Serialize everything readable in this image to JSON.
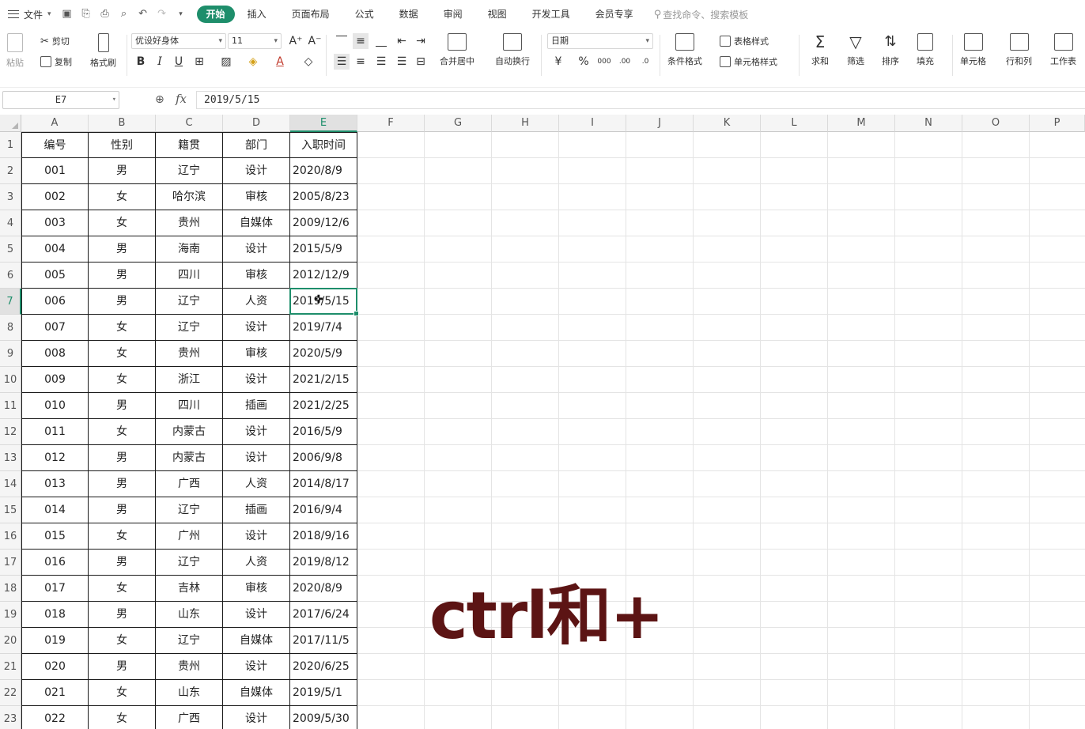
{
  "menu": {
    "file_label": "文件",
    "tabs": [
      "开始",
      "插入",
      "页面布局",
      "公式",
      "数据",
      "审阅",
      "视图",
      "开发工具",
      "会员专享"
    ],
    "active_tab": "开始",
    "search_placeholder": "查找命令、搜索模板"
  },
  "ribbon": {
    "paste": "粘贴",
    "cut": "剪切",
    "copy": "复制",
    "format_painter": "格式刷",
    "font_name": "优设好身体",
    "font_size": "11",
    "merge_center": "合并居中",
    "wrap_text": "自动换行",
    "number_format": "日期",
    "conditional_format": "条件格式",
    "table_style": "表格样式",
    "cell_style": "单元格样式",
    "sum": "求和",
    "filter": "筛选",
    "sort": "排序",
    "fill": "填充",
    "cell": "单元格",
    "row_col": "行和列",
    "worksheet": "工作表"
  },
  "formula_bar": {
    "name_box": "E7",
    "fx": "fx",
    "value": "2019/5/15"
  },
  "columns": [
    "A",
    "B",
    "C",
    "D",
    "E",
    "F",
    "G",
    "H",
    "I",
    "J",
    "K",
    "L",
    "M",
    "N",
    "O",
    "P"
  ],
  "selected_column": "E",
  "selected_row": 7,
  "table": {
    "headers": [
      "编号",
      "性别",
      "籍贯",
      "部门",
      "入职时间"
    ],
    "rows": [
      [
        "001",
        "男",
        "辽宁",
        "设计",
        "2020/8/9"
      ],
      [
        "002",
        "女",
        "哈尔滨",
        "审核",
        "2005/8/23"
      ],
      [
        "003",
        "女",
        "贵州",
        "自媒体",
        "2009/12/6"
      ],
      [
        "004",
        "男",
        "海南",
        "设计",
        "2015/5/9"
      ],
      [
        "005",
        "男",
        "四川",
        "审核",
        "2012/12/9"
      ],
      [
        "006",
        "男",
        "辽宁",
        "人资",
        "2019/5/15"
      ],
      [
        "007",
        "女",
        "辽宁",
        "设计",
        "2019/7/4"
      ],
      [
        "008",
        "女",
        "贵州",
        "审核",
        "2020/5/9"
      ],
      [
        "009",
        "女",
        "浙江",
        "设计",
        "2021/2/15"
      ],
      [
        "010",
        "男",
        "四川",
        "插画",
        "2021/2/25"
      ],
      [
        "011",
        "女",
        "内蒙古",
        "设计",
        "2016/5/9"
      ],
      [
        "012",
        "男",
        "内蒙古",
        "设计",
        "2006/9/8"
      ],
      [
        "013",
        "男",
        "广西",
        "人资",
        "2014/8/17"
      ],
      [
        "014",
        "男",
        "辽宁",
        "插画",
        "2016/9/4"
      ],
      [
        "015",
        "女",
        "广州",
        "设计",
        "2018/9/16"
      ],
      [
        "016",
        "男",
        "辽宁",
        "人资",
        "2019/8/12"
      ],
      [
        "017",
        "女",
        "吉林",
        "审核",
        "2020/8/9"
      ],
      [
        "018",
        "男",
        "山东",
        "设计",
        "2017/6/24"
      ],
      [
        "019",
        "女",
        "辽宁",
        "自媒体",
        "2017/11/5"
      ],
      [
        "020",
        "男",
        "贵州",
        "设计",
        "2020/6/25"
      ],
      [
        "021",
        "女",
        "山东",
        "自媒体",
        "2019/5/1"
      ],
      [
        "022",
        "女",
        "广西",
        "设计",
        "2009/5/30"
      ]
    ]
  },
  "overlay_text": "ctrl和+",
  "colors": {
    "accent": "#1e8e6b",
    "overlay": "#5c1414"
  }
}
